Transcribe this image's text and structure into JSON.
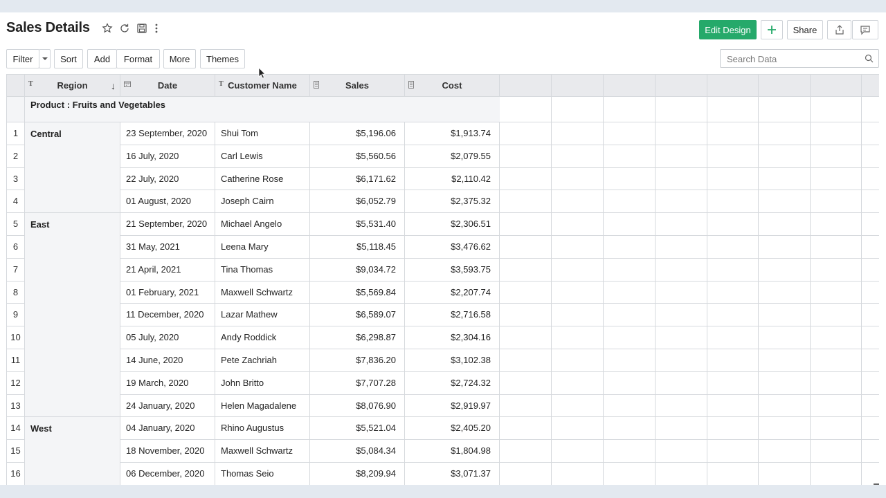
{
  "header": {
    "title": "Sales Details"
  },
  "toolbar": {
    "filter": "Filter",
    "sort": "Sort",
    "add": "Add",
    "format": "Format",
    "more": "More",
    "themes": "Themes"
  },
  "actions": {
    "edit_design": "Edit Design",
    "share": "Share"
  },
  "search": {
    "placeholder": "Search Data"
  },
  "table": {
    "columns": [
      "Region",
      "Date",
      "Customer Name",
      "Sales",
      "Cost"
    ],
    "group_label": "Product : Fruits and Vegetables",
    "regions": [
      "Central",
      "East",
      "West"
    ],
    "rows": [
      {
        "n": "1",
        "date": "23 September, 2020",
        "customer": "Shui Tom",
        "sales": "$5,196.06",
        "cost": "$1,913.74"
      },
      {
        "n": "2",
        "date": "16 July, 2020",
        "customer": "Carl Lewis",
        "sales": "$5,560.56",
        "cost": "$2,079.55"
      },
      {
        "n": "3",
        "date": "22 July, 2020",
        "customer": "Catherine Rose",
        "sales": "$6,171.62",
        "cost": "$2,110.42"
      },
      {
        "n": "4",
        "date": "01 August, 2020",
        "customer": "Joseph Cairn",
        "sales": "$6,052.79",
        "cost": "$2,375.32"
      },
      {
        "n": "5",
        "date": "21 September, 2020",
        "customer": "Michael Angelo",
        "sales": "$5,531.40",
        "cost": "$2,306.51"
      },
      {
        "n": "6",
        "date": "31 May, 2021",
        "customer": "Leena Mary",
        "sales": "$5,118.45",
        "cost": "$3,476.62"
      },
      {
        "n": "7",
        "date": "21 April, 2021",
        "customer": "Tina Thomas",
        "sales": "$9,034.72",
        "cost": "$3,593.75"
      },
      {
        "n": "8",
        "date": "01 February, 2021",
        "customer": "Maxwell Schwartz",
        "sales": "$5,569.84",
        "cost": "$2,207.74"
      },
      {
        "n": "9",
        "date": "11 December, 2020",
        "customer": "Lazar Mathew",
        "sales": "$6,589.07",
        "cost": "$2,716.58"
      },
      {
        "n": "10",
        "date": "05 July, 2020",
        "customer": "Andy Roddick",
        "sales": "$6,298.87",
        "cost": "$2,304.16"
      },
      {
        "n": "11",
        "date": "14 June, 2020",
        "customer": "Pete Zachriah",
        "sales": "$7,836.20",
        "cost": "$3,102.38"
      },
      {
        "n": "12",
        "date": "19 March, 2020",
        "customer": "John Britto",
        "sales": "$7,707.28",
        "cost": "$2,724.32"
      },
      {
        "n": "13",
        "date": "24 January, 2020",
        "customer": "Helen Magadalene",
        "sales": "$8,076.90",
        "cost": "$2,919.97"
      },
      {
        "n": "14",
        "date": "04 January, 2020",
        "customer": "Rhino Augustus",
        "sales": "$5,521.04",
        "cost": "$2,405.20"
      },
      {
        "n": "15",
        "date": "18 November, 2020",
        "customer": "Maxwell Schwartz",
        "sales": "$5,084.34",
        "cost": "$1,804.98"
      },
      {
        "n": "16",
        "date": "06 December, 2020",
        "customer": "Thomas Seio",
        "sales": "$8,209.94",
        "cost": "$3,071.37"
      }
    ]
  },
  "colors": {
    "accent": "#25a96a",
    "header_bg": "#e9eaed",
    "group_bg": "#f4f5f7"
  }
}
